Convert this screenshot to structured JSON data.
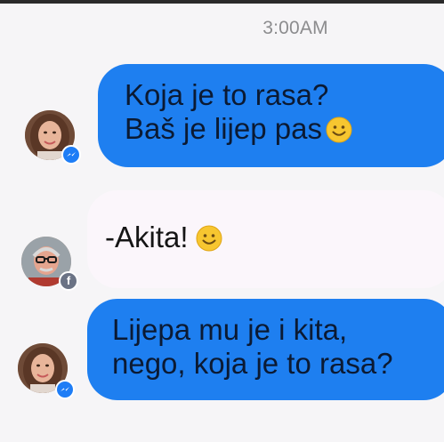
{
  "conversation": {
    "timestamp": "3:00AM",
    "messages": [
      {
        "sender": "woman",
        "lines": [
          "Koja je to rasa?",
          "Baš je lijep pas"
        ],
        "emoji": "smiley-emoji"
      },
      {
        "sender": "man",
        "lines": [
          "-Akita!"
        ],
        "emoji": "smiley-emoji"
      },
      {
        "sender": "woman",
        "lines": [
          "Lijepa mu je i kita,",
          "nego, koja je to rasa?"
        ],
        "emoji": null
      }
    ]
  },
  "colors": {
    "background": "#f6f5f7",
    "outgoing_bubble": "#1e7ff0",
    "incoming_bubble": "#fbf6fb",
    "timestamp_text": "#8c8c8e",
    "messenger_badge": "#1e7df6"
  }
}
